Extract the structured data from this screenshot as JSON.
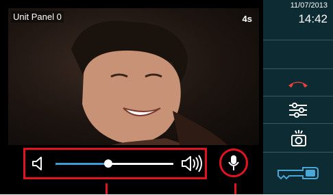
{
  "video": {
    "title": "Unit Panel 0",
    "timer": "4s"
  },
  "controls": {
    "volume_level": 0.45
  },
  "sidebar": {
    "date": "11/07/2013",
    "time": "14:42",
    "buttons": [
      "hang-up-icon",
      "settings-sliders-icon",
      "snapshot-camera-icon",
      "door-key-icon"
    ]
  },
  "colors": {
    "highlight": "#e2131f",
    "slider_fill": "#3a9fd6",
    "sidebar_bg": "#0d2b33",
    "hangup_red": "#e8423a",
    "key_blue": "#4aa8d8"
  }
}
